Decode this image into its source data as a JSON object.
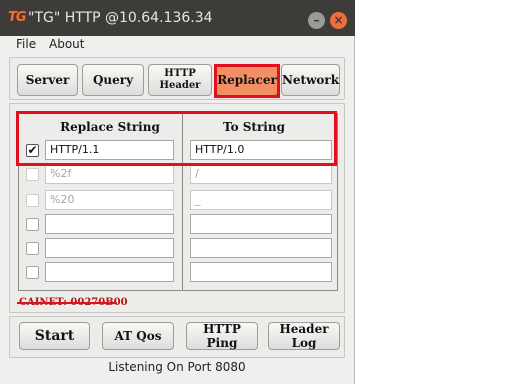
{
  "window": {
    "logo": "TG",
    "title": "\"TG\" HTTP @10.64.136.34",
    "minimize_glyph": "–",
    "close_glyph": "×"
  },
  "menu": [
    "File",
    "About"
  ],
  "tabs": [
    {
      "label": "Server"
    },
    {
      "label": "Query"
    },
    {
      "label_line1": "HTTP",
      "label_line2": "Header"
    },
    {
      "label": "Replacer",
      "active": true
    },
    {
      "label": "Network"
    }
  ],
  "replacer": {
    "headers": {
      "replace": "Replace String",
      "to": "To String"
    },
    "rows": [
      {
        "checked": true,
        "replace": "HTTP/1.1",
        "to": "HTTP/1.0",
        "enabled": true
      },
      {
        "checked": false,
        "replace": "%2f",
        "to": "/",
        "enabled": false
      },
      {
        "checked": false,
        "replace": "%20",
        "to": "_",
        "enabled": false
      },
      {
        "checked": false,
        "replace": "",
        "to": "",
        "enabled": true
      },
      {
        "checked": false,
        "replace": "",
        "to": "",
        "enabled": true
      },
      {
        "checked": false,
        "replace": "",
        "to": "",
        "enabled": true
      }
    ],
    "check_glyph": "✔"
  },
  "watermark": "CAINET: 00270B00",
  "actions": {
    "start": "Start",
    "at_qos": "AT Qos",
    "http_ping": "HTTP Ping",
    "header_log": "Header Log"
  },
  "status": "Listening On Port 8080",
  "colors": {
    "titlebar": "#3d3c38",
    "active_tab": "#f28f65",
    "highlight": "#e1101c",
    "close_button": "#f16c3d"
  }
}
